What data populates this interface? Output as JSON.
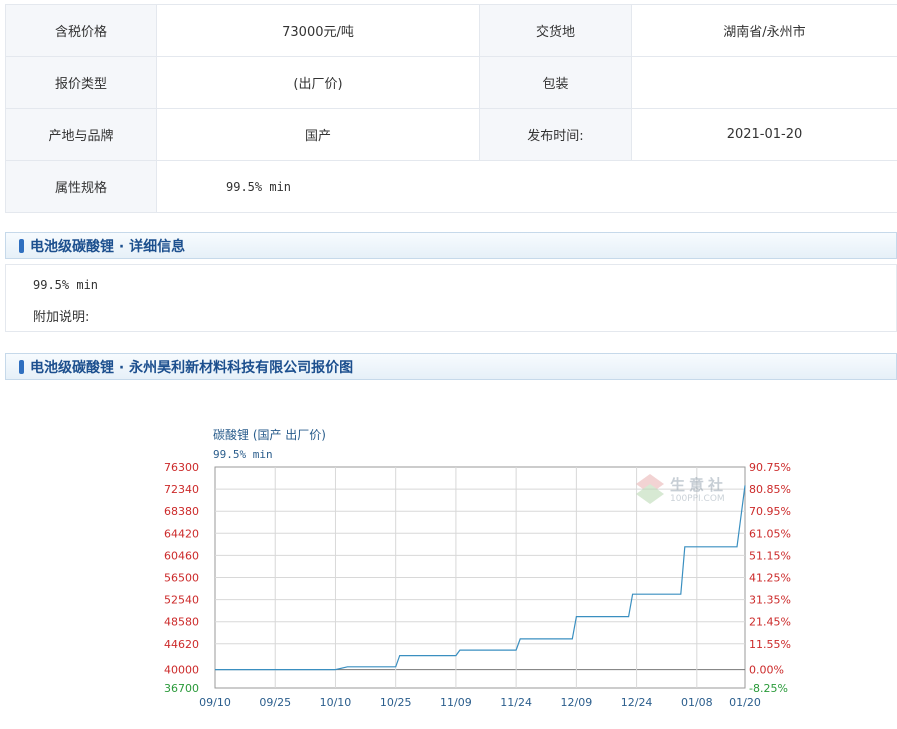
{
  "info": {
    "row1": {
      "label1": "含税价格",
      "value1": "73000元/吨",
      "label2": "交货地",
      "value2": "湖南省/永州市"
    },
    "row2": {
      "label1": "报价类型",
      "value1": "(出厂价)",
      "label2": "包装",
      "value2": ""
    },
    "row3": {
      "label1": "产地与品牌",
      "value1": "国产",
      "label2": "发布时间:",
      "value2": "2021-01-20"
    },
    "row4": {
      "label1": "属性规格",
      "value1": "99.5% min"
    }
  },
  "detail": {
    "heading": "电池级碳酸锂 · 详细信息",
    "spec": "99.5% min",
    "note_label": "附加说明:"
  },
  "chart_section": {
    "heading": "电池级碳酸锂 · 永州昊利新材料科技有限公司报价图"
  },
  "watermark": {
    "cn": "生意社",
    "en": "100PPI.COM"
  },
  "colors": {
    "accent": "#2f6fbf",
    "line": "#3a8fc0",
    "up": "#cc2a2a",
    "down": "#2a9a3a"
  },
  "chart_data": {
    "type": "line",
    "title": "碳酸锂 (国产 出厂价)",
    "subtitle": "99.5% min",
    "x_ticks": [
      "09/10",
      "09/25",
      "10/10",
      "10/25",
      "11/09",
      "11/24",
      "12/09",
      "12/24",
      "01/08",
      "01/20"
    ],
    "y_left_ticks": [
      76300,
      72340,
      68380,
      64420,
      60460,
      56500,
      52540,
      48580,
      44620,
      40000,
      36700
    ],
    "y_right_ticks": [
      "90.75%",
      "80.85%",
      "70.95%",
      "61.05%",
      "51.15%",
      "41.25%",
      "31.35%",
      "21.45%",
      "11.55%",
      "0.00%",
      "-8.25%"
    ],
    "ylim": [
      36700,
      76300
    ],
    "grid": true,
    "series": [
      {
        "points": [
          [
            "09/10",
            40000
          ],
          [
            "10/10",
            40000
          ],
          [
            "10/13",
            40500
          ],
          [
            "10/25",
            40500
          ],
          [
            "10/26",
            42500
          ],
          [
            "11/09",
            42500
          ],
          [
            "11/10",
            43500
          ],
          [
            "11/24",
            43500
          ],
          [
            "11/25",
            45500
          ],
          [
            "12/08",
            45500
          ],
          [
            "12/09",
            49500
          ],
          [
            "12/22",
            49500
          ],
          [
            "12/23",
            53500
          ],
          [
            "01/04",
            53500
          ],
          [
            "01/05",
            62000
          ],
          [
            "01/18",
            62000
          ],
          [
            "01/20",
            73000
          ]
        ]
      }
    ]
  }
}
